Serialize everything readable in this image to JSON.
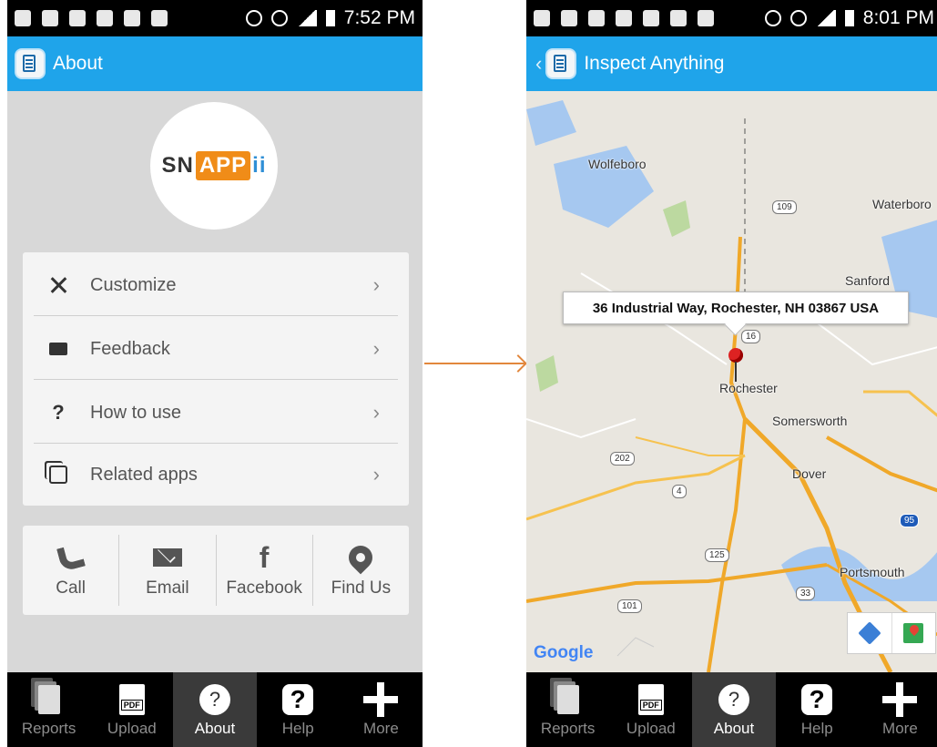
{
  "left": {
    "status_time": "7:52 PM",
    "title": "About",
    "logo": {
      "part1": "SN",
      "part2": "APP",
      "part3": "ii"
    },
    "menu": [
      {
        "label": "Customize",
        "icon": "tools-icon"
      },
      {
        "label": "Feedback",
        "icon": "feedback-icon"
      },
      {
        "label": "How to use",
        "icon": "question-icon"
      },
      {
        "label": "Related apps",
        "icon": "related-apps-icon"
      }
    ],
    "chevron": "›",
    "contacts": [
      {
        "label": "Call",
        "icon": "phone-icon"
      },
      {
        "label": "Email",
        "icon": "mail-icon"
      },
      {
        "label": "Facebook",
        "icon": "facebook-icon"
      },
      {
        "label": "Find Us",
        "icon": "location-pin-icon"
      }
    ],
    "nav": [
      "Reports",
      "Upload",
      "About",
      "Help",
      "More"
    ],
    "active_nav": "About"
  },
  "right": {
    "status_time": "8:01 PM",
    "title": "Inspect Anything",
    "address": "36 Industrial Way,  Rochester, NH 03867 USA",
    "places": [
      "Wolfeboro",
      "Waterboro",
      "Sanford",
      "Rochester",
      "Somersworth",
      "Dover",
      "Portsmouth"
    ],
    "route_shields": [
      "109",
      "16",
      "202",
      "4",
      "125",
      "101",
      "33",
      "95"
    ],
    "google_label": "Google",
    "nav": [
      "Reports",
      "Upload",
      "About",
      "Help",
      "More"
    ],
    "active_nav": "About"
  },
  "colors": {
    "appbar": "#1fa4ea",
    "accent_orange": "#f08c18",
    "arrow": "#e2873c"
  }
}
